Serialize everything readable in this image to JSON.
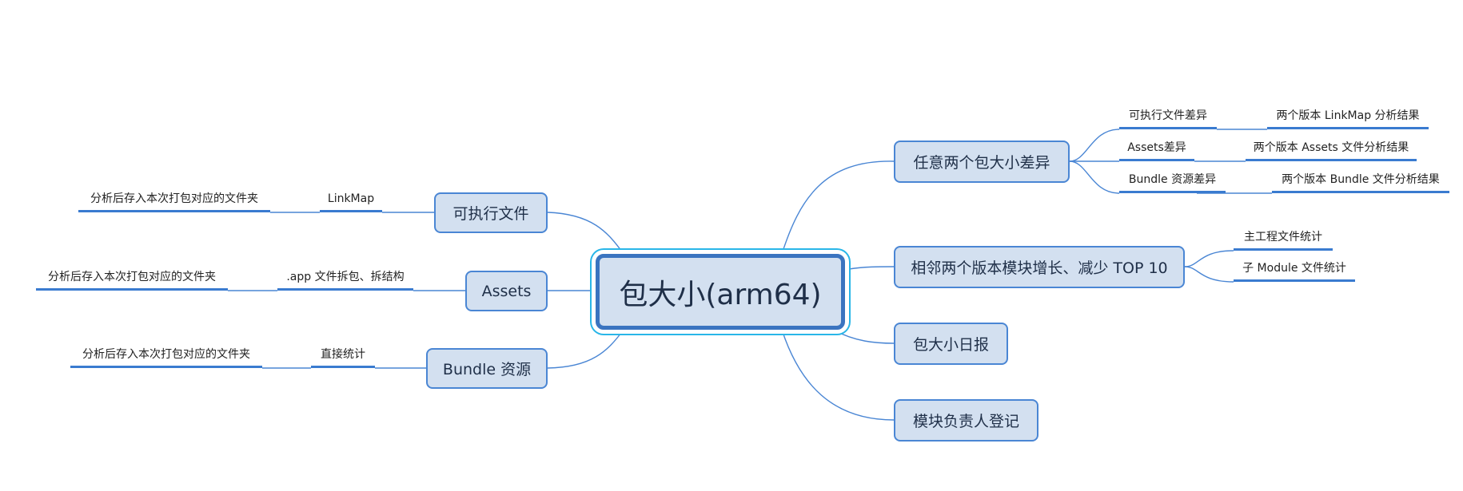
{
  "root": {
    "label": "包大小(arm64)"
  },
  "left": {
    "executable": {
      "label": "可执行文件",
      "child": "LinkMap",
      "grandchild": "分析后存入本次打包对应的文件夹"
    },
    "assets": {
      "label": "Assets",
      "child": ".app 文件拆包、拆结构",
      "grandchild": "分析后存入本次打包对应的文件夹"
    },
    "bundle": {
      "label": "Bundle 资源",
      "child": "直接统计",
      "grandchild": "分析后存入本次打包对应的文件夹"
    }
  },
  "right": {
    "diff": {
      "label": "任意两个包大小差异",
      "children": [
        {
          "label": "可执行文件差异",
          "result": "两个版本 LinkMap 分析结果"
        },
        {
          "label": "Assets差异",
          "result": "两个版本 Assets 文件分析结果"
        },
        {
          "label": "Bundle 资源差异",
          "result": "两个版本 Bundle 文件分析结果"
        }
      ]
    },
    "top10": {
      "label": "相邻两个版本模块增长、减少 TOP 10",
      "children": [
        {
          "label": "主工程文件统计"
        },
        {
          "label": "子 Module 文件统计"
        }
      ]
    },
    "daily": {
      "label": "包大小日报"
    },
    "owner": {
      "label": "模块负责人登记"
    }
  }
}
